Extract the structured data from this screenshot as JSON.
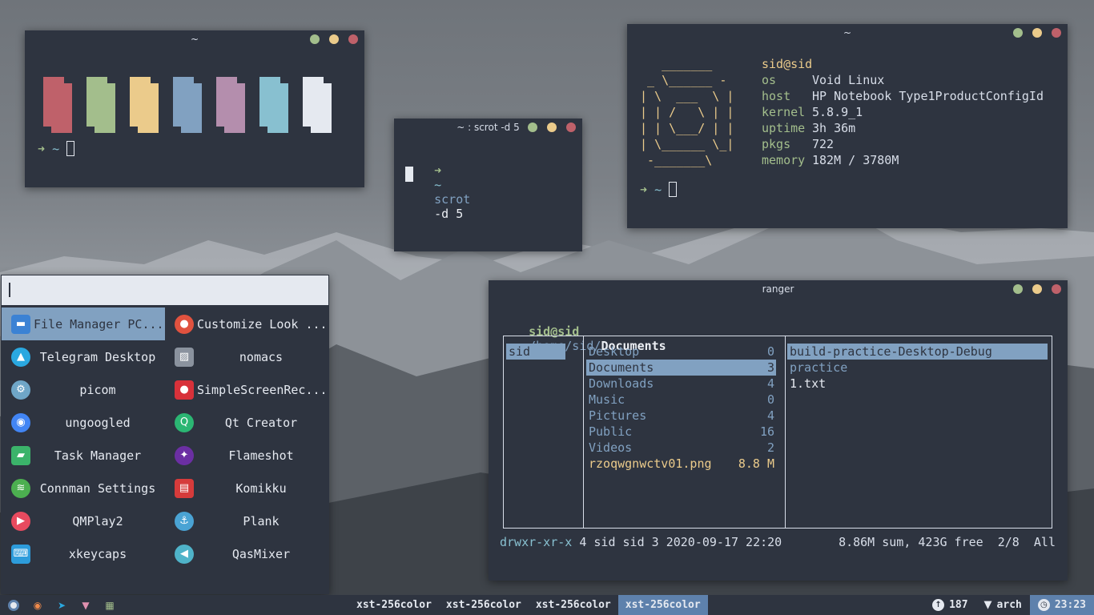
{
  "colors": {
    "bg": "#2e3440",
    "fg": "#d8dee9",
    "green": "#a3be8c",
    "yellow": "#ebcb8b",
    "red": "#bf616a",
    "blue": "#81a1c1",
    "cyan": "#88c0d0",
    "purple": "#b48ead",
    "accent": "#5e81ac"
  },
  "term1": {
    "title": "~",
    "prompt_arrow": "➜",
    "prompt_dir": "~",
    "blocks": [
      "#bf616a",
      "#a3be8c",
      "#ebcb8b",
      "#81a1c1",
      "#b48ead",
      "#88c0d0",
      "#e5e9f0"
    ]
  },
  "term2": {
    "title": "~ : scrot -d 5",
    "prompt_arrow": "➜",
    "prompt_dir": "~",
    "command": "scrot",
    "args": "-d 5"
  },
  "fetch": {
    "title": "~",
    "ascii": "   _______\n _ \\______ -\n| \\  ___  \\ |\n| | /   \\ | |\n| | \\___/ | |\n| \\______ \\_|\n -_______\\",
    "user": "sid@sid",
    "rows": [
      {
        "key": "os",
        "value": "Void Linux"
      },
      {
        "key": "host",
        "value": "HP Notebook Type1ProductConfigId"
      },
      {
        "key": "kernel",
        "value": "5.8.9_1"
      },
      {
        "key": "uptime",
        "value": "3h 36m"
      },
      {
        "key": "pkgs",
        "value": "722"
      },
      {
        "key": "memory",
        "value": "182M / 3780M"
      }
    ],
    "prompt_arrow": "➜",
    "prompt_dir": "~"
  },
  "ranger": {
    "title": "ranger",
    "user": "sid@sid",
    "path": "/home/sid/",
    "current": "Documents",
    "parent": [
      "sid"
    ],
    "entries": [
      {
        "name": "Desktop",
        "count": "0"
      },
      {
        "name": "Documents",
        "count": "3"
      },
      {
        "name": "Downloads",
        "count": "4"
      },
      {
        "name": "Music",
        "count": "0"
      },
      {
        "name": "Pictures",
        "count": "4"
      },
      {
        "name": "Public",
        "count": "16"
      },
      {
        "name": "Videos",
        "count": "2"
      },
      {
        "name": "rzoqwgnwctv01.png",
        "count": "8.8 M"
      }
    ],
    "preview": [
      "build-practice-Desktop-Debug",
      "practice",
      "1.txt"
    ],
    "status_perms": "drwxr-xr-x",
    "status_info": "4 sid sid 3 2020-09-17 22:20",
    "status_right": "8.86M sum, 423G free  2/8  All"
  },
  "menu": {
    "search_value": "",
    "apps": [
      {
        "label": "File Manager PC...",
        "icon": "folder-icon",
        "color": "#3b82d4"
      },
      {
        "label": "Customize Look ...",
        "icon": "palette-icon",
        "color": "#e0523f"
      },
      {
        "label": "Telegram Desktop",
        "icon": "telegram-icon",
        "color": "#2aa8e0"
      },
      {
        "label": "nomacs",
        "icon": "image-viewer-icon",
        "color": "#8a929e"
      },
      {
        "label": "picom",
        "icon": "gear-icon",
        "color": "#6fa6c7"
      },
      {
        "label": "SimpleScreenRec...",
        "icon": "record-icon",
        "color": "#d8313a"
      },
      {
        "label": "ungoogled",
        "icon": "chromium-icon",
        "color": "#4285f4"
      },
      {
        "label": "Qt Creator",
        "icon": "qt-icon",
        "color": "#2bb673"
      },
      {
        "label": "Task Manager",
        "icon": "monitor-icon",
        "color": "#3bb36a"
      },
      {
        "label": "Flameshot",
        "icon": "flameshot-icon",
        "color": "#6b2fa3"
      },
      {
        "label": "Connman Settings",
        "icon": "network-icon",
        "color": "#4caf50"
      },
      {
        "label": "Komikku",
        "icon": "book-icon",
        "color": "#d63b3b"
      },
      {
        "label": "QMPlay2",
        "icon": "play-icon",
        "color": "#e84a5f"
      },
      {
        "label": "Plank",
        "icon": "anchor-icon",
        "color": "#4aa3d4"
      },
      {
        "label": "xkeycaps",
        "icon": "keyboard-icon",
        "color": "#2d9cdb"
      },
      {
        "label": "QasMixer",
        "icon": "speaker-icon",
        "color": "#4fb3c9"
      }
    ]
  },
  "taskbar": {
    "tasks": [
      "xst-256color",
      "xst-256color",
      "xst-256color",
      "xst-256color"
    ],
    "updates": "187",
    "network": "arch",
    "clock": "23:23"
  }
}
